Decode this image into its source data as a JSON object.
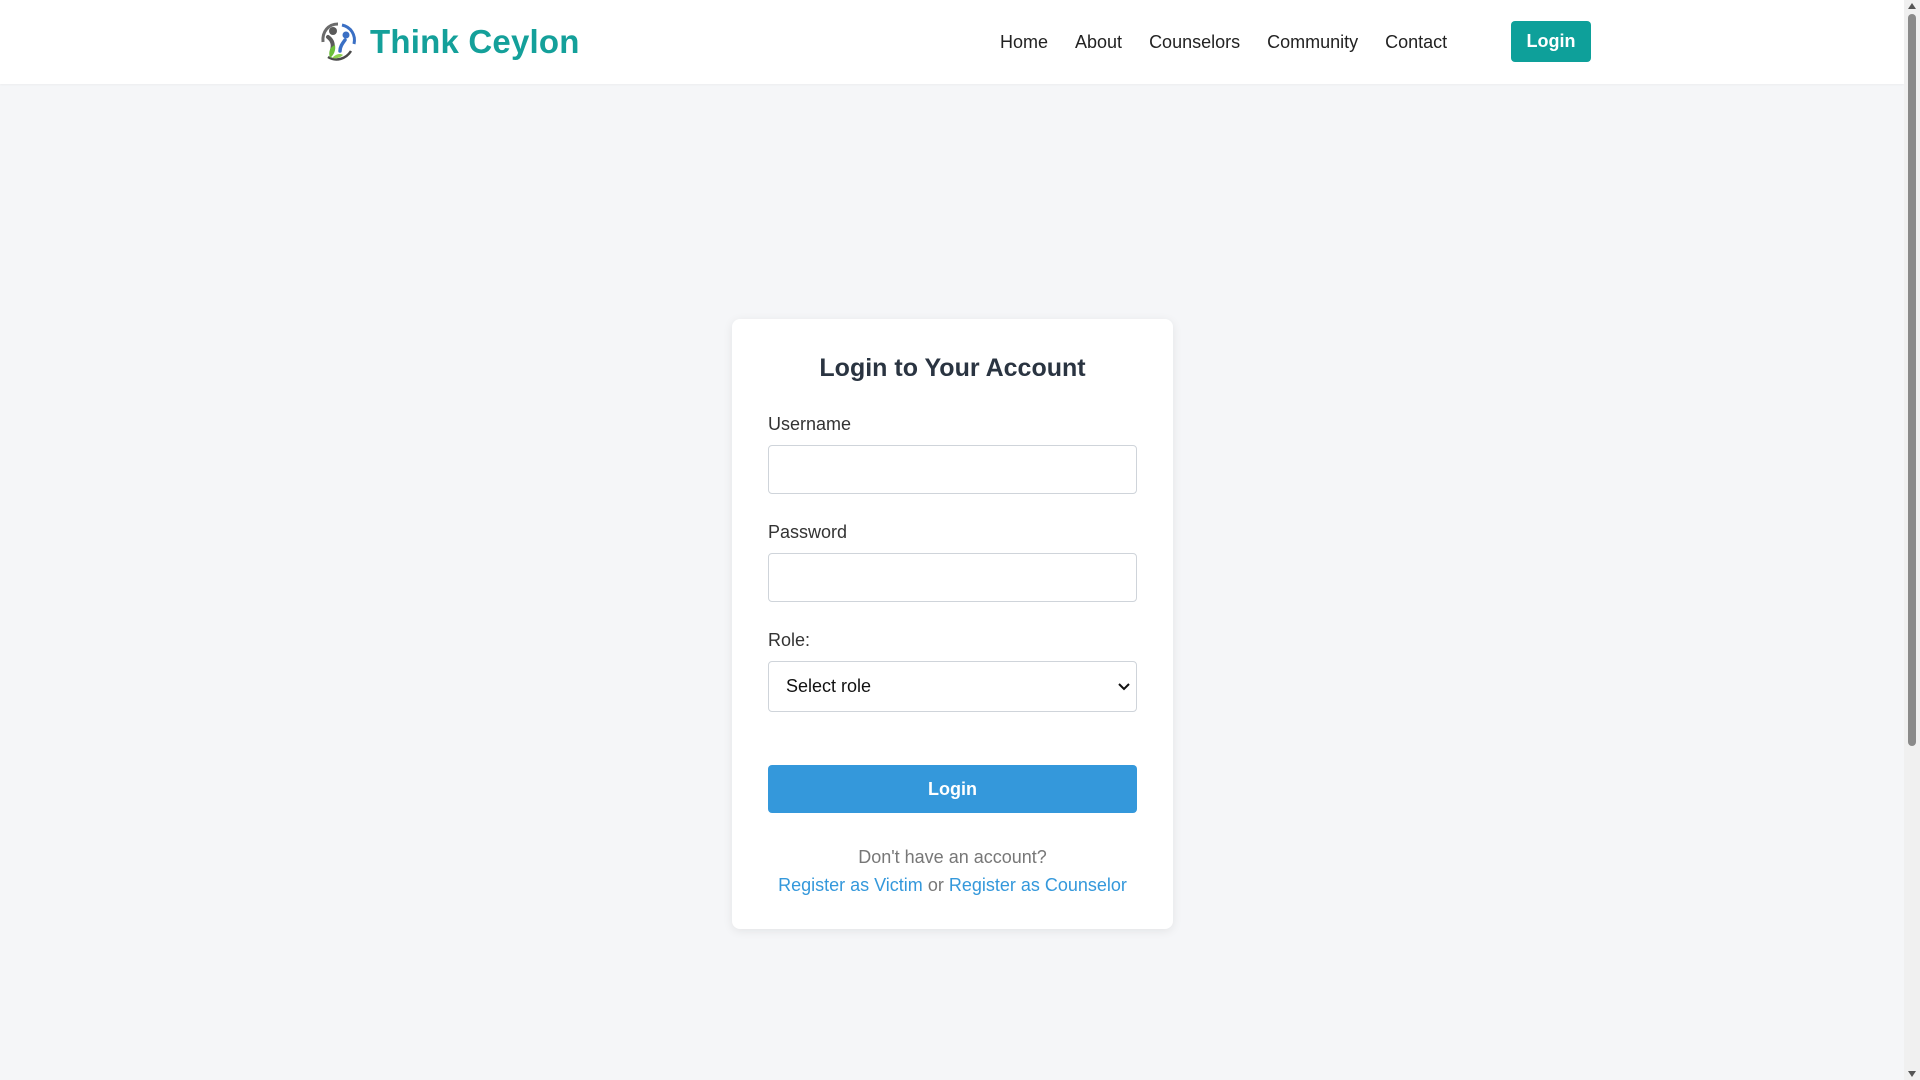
{
  "brand": {
    "name": "Think Ceylon",
    "color": "#14a09a",
    "logo_icon": "people-circle-logo-icon"
  },
  "nav": {
    "items": [
      "Home",
      "About",
      "Counselors",
      "Community",
      "Contact"
    ],
    "login_label": "Login"
  },
  "login_form": {
    "title": "Login to Your Account",
    "username_label": "Username",
    "username_value": "",
    "password_label": "Password",
    "password_value": "",
    "role_label": "Role:",
    "role_selected": "Select role",
    "submit_label": "Login",
    "no_account_text": "Don't have an account?",
    "register_victim_label": "Register as Victim",
    "or_text": "or",
    "register_counselor_label": "Register as Counselor"
  },
  "colors": {
    "accent_teal": "#0ea09a",
    "primary_blue": "#3498db",
    "background": "#f5f6f8"
  }
}
